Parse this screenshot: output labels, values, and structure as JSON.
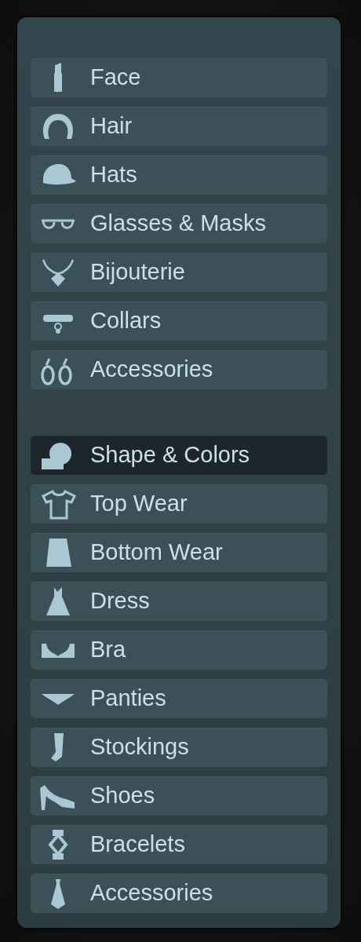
{
  "groups": [
    {
      "items": [
        {
          "label": "Face",
          "selected": false
        },
        {
          "label": "Hair",
          "selected": false
        },
        {
          "label": "Hats",
          "selected": false
        },
        {
          "label": "Glasses & Masks",
          "selected": false
        },
        {
          "label": "Bijouterie",
          "selected": false
        },
        {
          "label": "Collars",
          "selected": false
        },
        {
          "label": "Accessories",
          "selected": false
        }
      ]
    },
    {
      "items": [
        {
          "label": "Shape & Colors",
          "selected": true
        },
        {
          "label": "Top Wear",
          "selected": false
        },
        {
          "label": "Bottom Wear",
          "selected": false
        },
        {
          "label": "Dress",
          "selected": false
        },
        {
          "label": "Bra",
          "selected": false
        },
        {
          "label": "Panties",
          "selected": false
        },
        {
          "label": "Stockings",
          "selected": false
        },
        {
          "label": "Shoes",
          "selected": false
        },
        {
          "label": "Bracelets",
          "selected": false
        },
        {
          "label": "Accessories",
          "selected": false
        }
      ]
    }
  ]
}
